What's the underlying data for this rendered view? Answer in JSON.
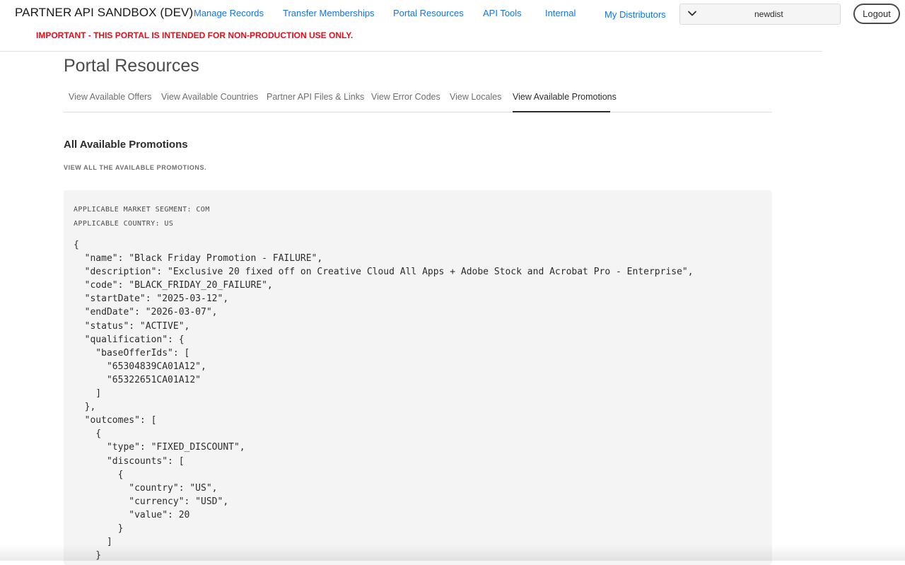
{
  "header": {
    "brand": "PARTNER API SANDBOX (DEV)",
    "warning": "IMPORTANT - THIS PORTAL IS INTENDED FOR NON-PRODUCTION USE ONLY.",
    "nav": [
      {
        "label": "Manage Records"
      },
      {
        "label": "Transfer Memberships"
      },
      {
        "label": "Portal Resources"
      },
      {
        "label": "API Tools"
      },
      {
        "label": "Internal"
      },
      {
        "label": "My Distributors"
      }
    ],
    "distributor_select": {
      "value": "newdist",
      "icon": "chevron-down-icon"
    },
    "logout_label": "Logout"
  },
  "page": {
    "title": "Portal Resources",
    "tabs": [
      {
        "label": "View Available Offers",
        "active": false
      },
      {
        "label": "View Available Countries",
        "active": false
      },
      {
        "label": "Partner API Files & Links",
        "active": false
      },
      {
        "label": "View Error Codes",
        "active": false
      },
      {
        "label": "View Locales",
        "active": false
      },
      {
        "label": "View Available Promotions",
        "active": true
      }
    ]
  },
  "section": {
    "title": "All Available Promotions",
    "subtitle": "VIEW ALL THE AVAILABLE PROMOTIONS.",
    "market_segment_line": "APPLICABLE MARKET SEGMENT: COM",
    "country_line": "APPLICABLE COUNTRY: US",
    "code": "{\n  \"name\": \"Black Friday Promotion - FAILURE\",\n  \"description\": \"Exclusive 20 fixed off on Creative Cloud All Apps + Adobe Stock and Acrobat Pro - Enterprise\",\n  \"code\": \"BLACK_FRIDAY_20_FAILURE\",\n  \"startDate\": \"2025-03-12\",\n  \"endDate\": \"2026-03-07\",\n  \"status\": \"ACTIVE\",\n  \"qualification\": {\n    \"baseOfferIds\": [\n      \"65304839CA01A12\",\n      \"65322651CA01A12\"\n    ]\n  },\n  \"outcomes\": [\n    {\n      \"type\": \"FIXED_DISCOUNT\",\n      \"discounts\": [\n        {\n          \"country\": \"US\",\n          \"currency\": \"USD\",\n          \"value\": 20\n        }\n      ]\n    }"
  },
  "colors": {
    "link": "#1473e6",
    "warning": "#e0101a",
    "code_bg": "#f4f4f4"
  }
}
